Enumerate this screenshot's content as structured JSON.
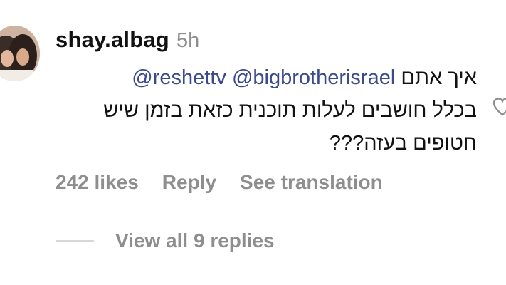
{
  "comment": {
    "username": "shay.albag",
    "time": "5h",
    "mentions": [
      "@reshettv",
      "@bigbrotherisrael"
    ],
    "line1_hebrew": "איך אתם",
    "line2": "בכלל חושבים לעלות תוכנית כזאת בזמן שיש",
    "line3": "חטופים בעזה???",
    "like_icon": "heart-outline-icon"
  },
  "actions": {
    "likes": "242 likes",
    "reply": "Reply",
    "see_translation": "See translation"
  },
  "replies": {
    "view_all": "View all 9 replies"
  },
  "colors": {
    "text": "#111111",
    "secondary": "#8e8e8e",
    "mention": "#3b4a8c"
  }
}
